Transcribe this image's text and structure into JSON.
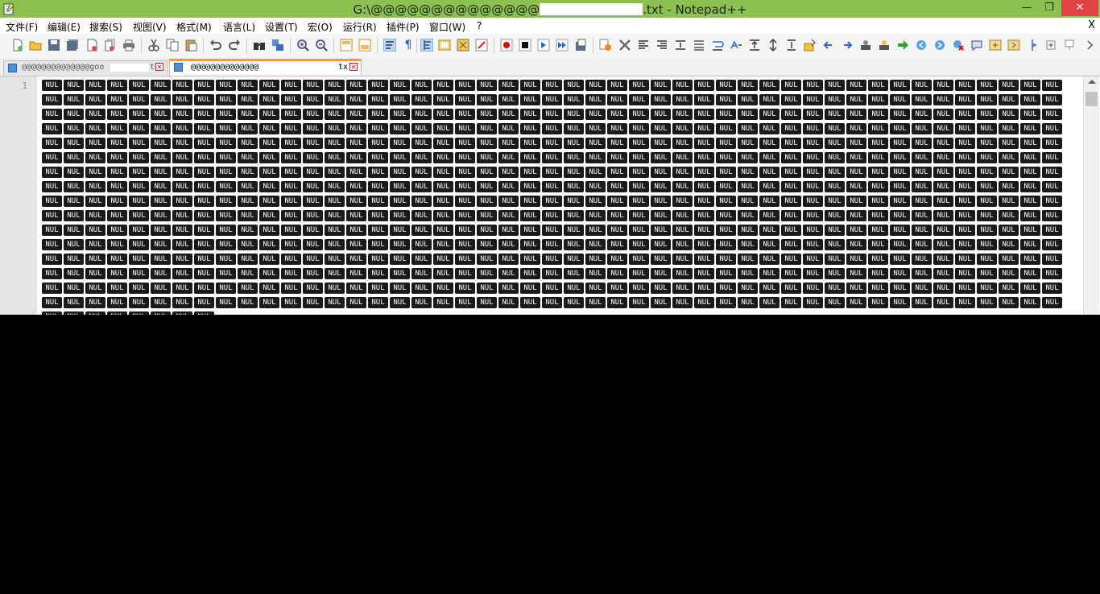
{
  "titlebar": {
    "title_prefix": "G:\\@@@@@@@@@@@@@@",
    "title_suffix": ".txt - Notepad++",
    "minimize": "—",
    "restore": "❐",
    "close": "✕"
  },
  "menu": {
    "items": [
      "文件(F)",
      "编辑(E)",
      "搜索(S)",
      "视图(V)",
      "格式(M)",
      "语言(L)",
      "设置(T)",
      "宏(O)",
      "运行(R)",
      "插件(P)",
      "窗口(W)",
      "?"
    ],
    "close": "X"
  },
  "toolbar": {
    "icons": [
      "new-file-icon",
      "open-file-icon",
      "save-icon",
      "save-all-icon",
      "close-icon",
      "close-all-icon",
      "print-icon",
      "cut-icon",
      "copy-icon",
      "paste-icon",
      "undo-icon",
      "redo-icon",
      "find-icon",
      "replace-icon",
      "zoom-in-icon",
      "zoom-out-icon",
      "sync-vertical-icon",
      "sync-horizontal-icon",
      "word-wrap-icon",
      "show-all-chars-icon",
      "indent-guide-icon",
      "doc-map-icon",
      "function-list-icon",
      "folder-workspace-icon",
      "record-macro-icon",
      "stop-macro-icon",
      "play-macro-icon",
      "run-macro-multiple-icon",
      "save-macro-icon"
    ]
  },
  "tabs": [
    {
      "label": "@@@@@@@@@@@@@@goo",
      "suffix": "txt",
      "active": false
    },
    {
      "label": "@@@@@@@@@@@@@@",
      "suffix": "tx",
      "active": true
    }
  ],
  "editor": {
    "line_number": "1",
    "char_token": "NUL",
    "tokens_per_row": 47,
    "full_rows": 16,
    "partial_row_tokens": 8
  },
  "colors": {
    "titlebar": "#8cc152",
    "active_tab_accent": "#f6a21a",
    "close_button": "#e04343"
  }
}
